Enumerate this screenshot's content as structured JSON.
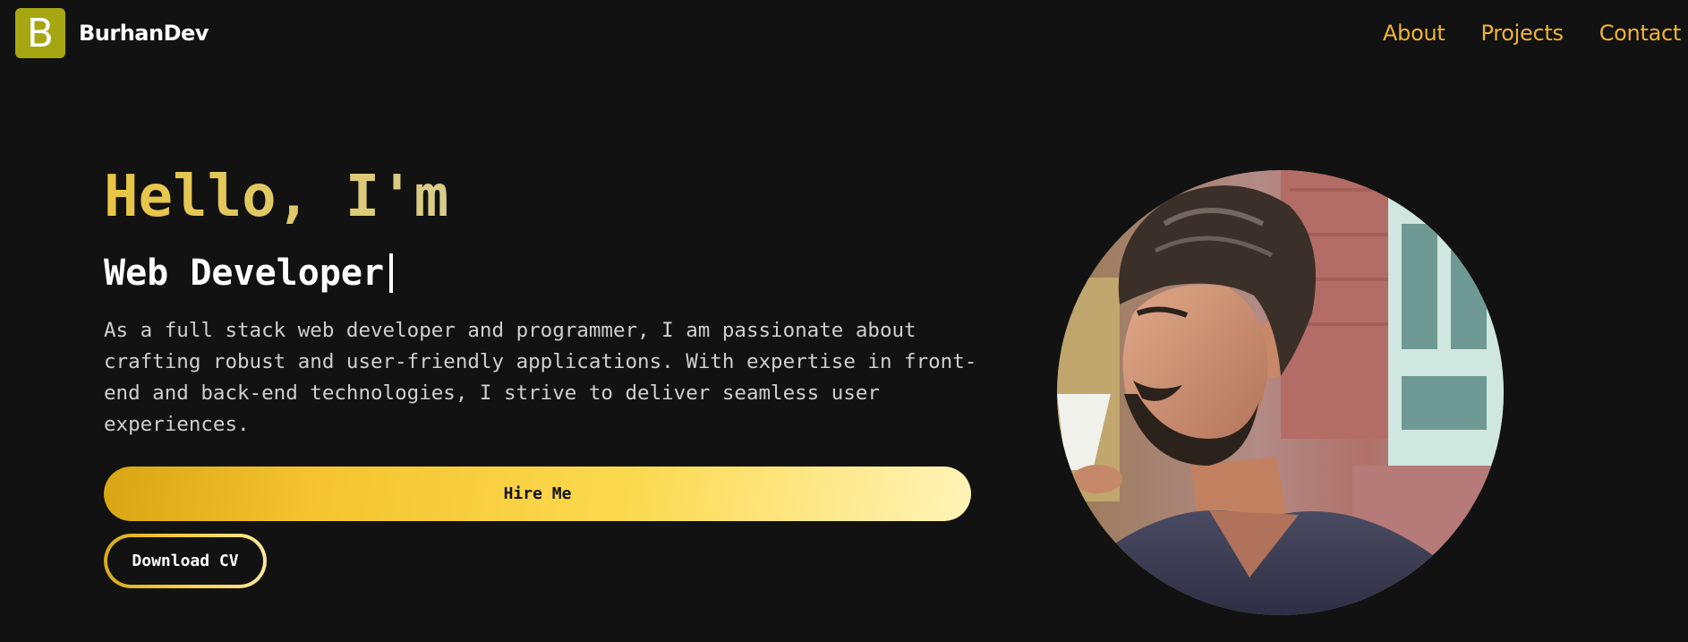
{
  "header": {
    "logo_letter": "B",
    "brand": "BurhanDev",
    "nav": [
      "About",
      "Projects",
      "Contact"
    ]
  },
  "hero": {
    "greeting": "Hello, I'm",
    "role": "Web Developer",
    "bio": "As a full stack web developer and programmer, I am passionate about crafting robust and user-friendly applications. With expertise in front-end and back-end technologies, I strive to deliver seamless user experiences.",
    "hire_label": "Hire Me",
    "cv_label": "Download CV"
  },
  "colors": {
    "background": "#121212",
    "accent": "#f0b432",
    "logo": "#a6a612"
  }
}
